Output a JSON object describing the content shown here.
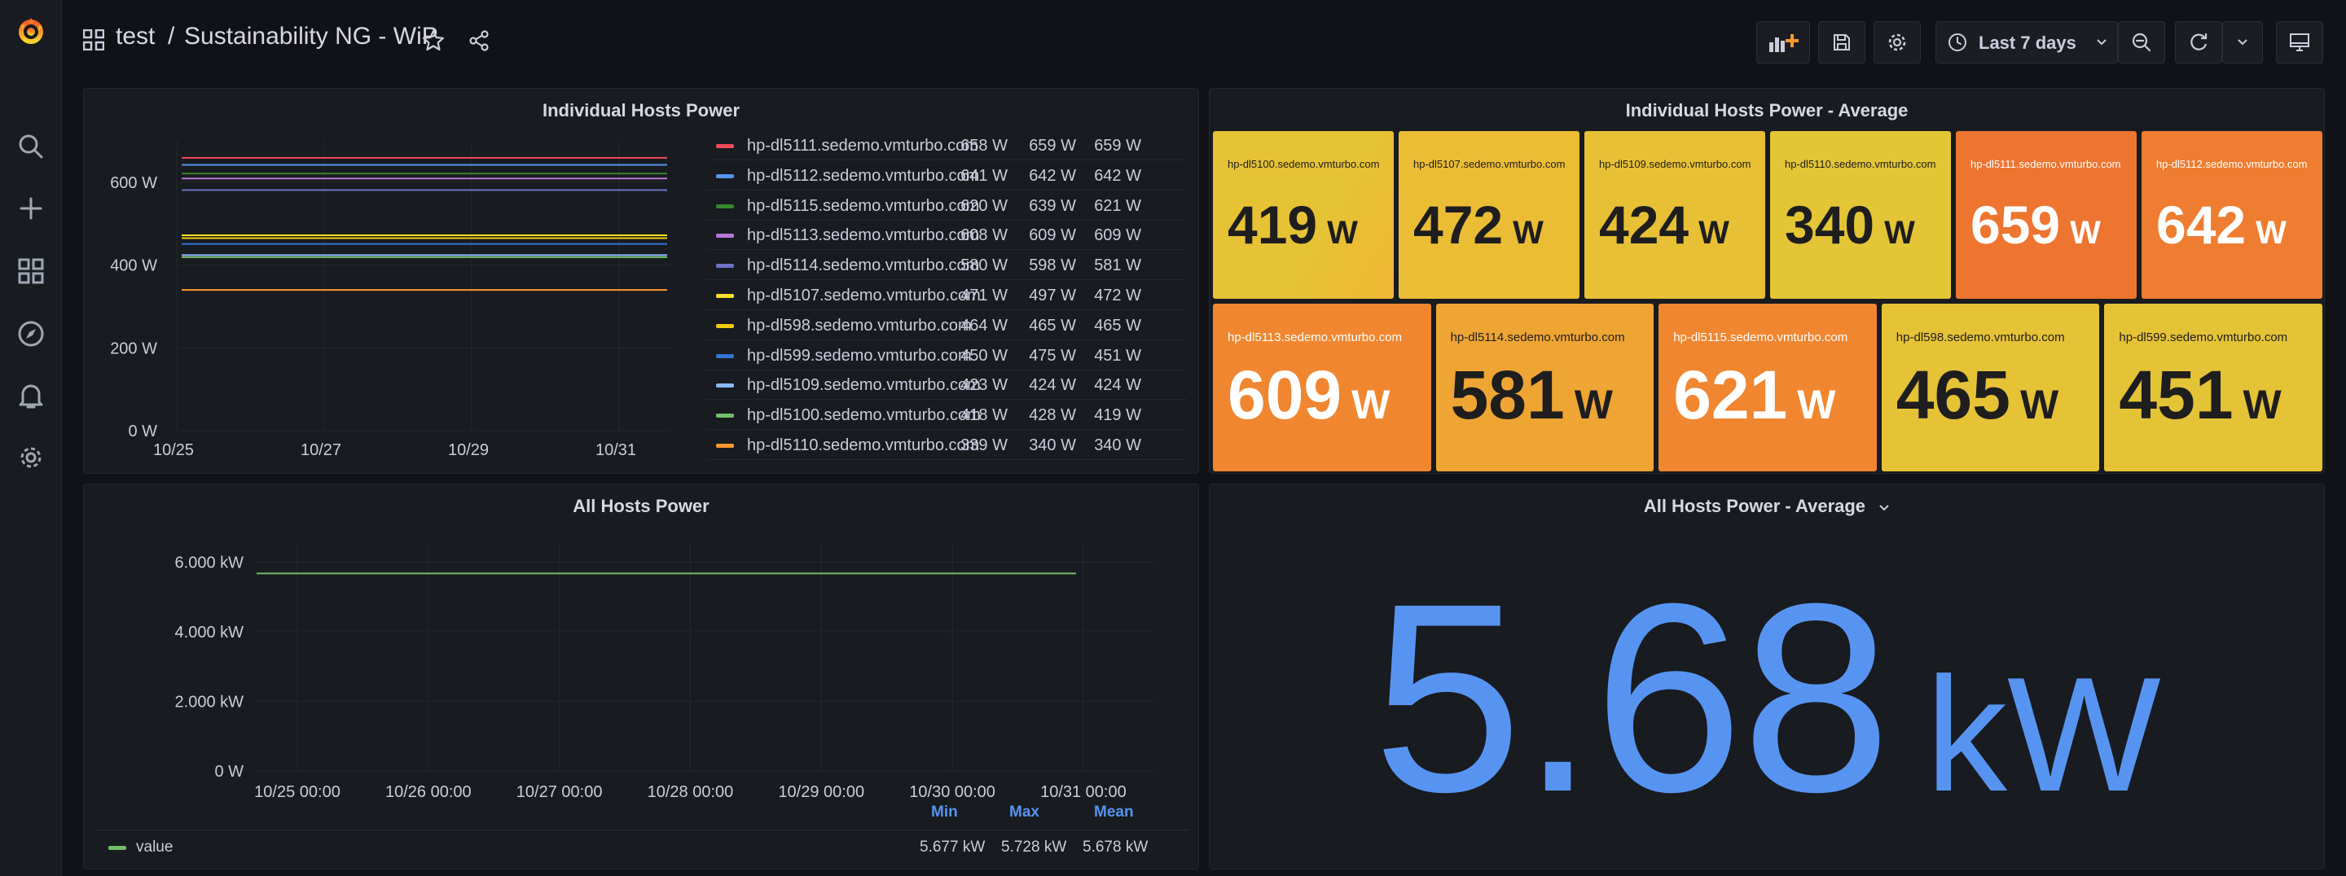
{
  "breadcrumb": {
    "folder": "test",
    "separator": "/",
    "dashboard": "Sustainability NG - WiP"
  },
  "toolbar": {
    "time_range": "Last 7 days"
  },
  "panels": {
    "individual_power": {
      "title": "Individual Hosts Power",
      "y_ticks": [
        "600 W",
        "400 W",
        "200 W",
        "0 W"
      ],
      "x_ticks": [
        "10/25",
        "10/27",
        "10/29",
        "10/31"
      ],
      "legend": [
        {
          "name": "hp-dl5111.sedemo.vmturbo.com",
          "color": "#f2495c",
          "min": "658 W",
          "max": "659 W",
          "last": "659 W",
          "level": 659
        },
        {
          "name": "hp-dl5112.sedemo.vmturbo.com",
          "color": "#5794f2",
          "min": "641 W",
          "max": "642 W",
          "last": "642 W",
          "level": 642
        },
        {
          "name": "hp-dl5115.sedemo.vmturbo.com",
          "color": "#37872d",
          "min": "620 W",
          "max": "639 W",
          "last": "621 W",
          "level": 621
        },
        {
          "name": "hp-dl5113.sedemo.vmturbo.com",
          "color": "#b877d9",
          "min": "608 W",
          "max": "609 W",
          "last": "609 W",
          "level": 609
        },
        {
          "name": "hp-dl5114.sedemo.vmturbo.com",
          "color": "#6e73c7",
          "min": "580 W",
          "max": "598 W",
          "last": "581 W",
          "level": 581
        },
        {
          "name": "hp-dl5107.sedemo.vmturbo.com",
          "color": "#fade2a",
          "min": "471 W",
          "max": "497 W",
          "last": "472 W",
          "level": 472
        },
        {
          "name": "hp-dl598.sedemo.vmturbo.com",
          "color": "#f2cc0c",
          "min": "464 W",
          "max": "465 W",
          "last": "465 W",
          "level": 465
        },
        {
          "name": "hp-dl599.sedemo.vmturbo.com",
          "color": "#3274d9",
          "min": "450 W",
          "max": "475 W",
          "last": "451 W",
          "level": 451
        },
        {
          "name": "hp-dl5109.sedemo.vmturbo.com",
          "color": "#8ab8ff",
          "min": "423 W",
          "max": "424 W",
          "last": "424 W",
          "level": 424
        },
        {
          "name": "hp-dl5100.sedemo.vmturbo.com",
          "color": "#73bf69",
          "min": "418 W",
          "max": "428 W",
          "last": "419 W",
          "level": 419
        },
        {
          "name": "hp-dl5110.sedemo.vmturbo.com",
          "color": "#ff9830",
          "min": "339 W",
          "max": "340 W",
          "last": "340 W",
          "level": 340
        }
      ]
    },
    "individual_avg": {
      "title": "Individual Hosts Power - Average",
      "tiles": [
        {
          "name": "hp-dl5100.sedemo.vmturbo.com",
          "value": "419",
          "unit": "W",
          "color": "#e6c235"
        },
        {
          "name": "hp-dl5107.sedemo.vmturbo.com",
          "value": "472",
          "unit": "W",
          "color": "#ebbd35"
        },
        {
          "name": "hp-dl5109.sedemo.vmturbo.com",
          "value": "424",
          "unit": "W",
          "color": "#e8c035"
        },
        {
          "name": "hp-dl5110.sedemo.vmturbo.com",
          "value": "340",
          "unit": "W",
          "color": "#e3c536"
        },
        {
          "name": "hp-dl5111.sedemo.vmturbo.com",
          "value": "659",
          "unit": "W",
          "color": "#ee7530"
        },
        {
          "name": "hp-dl5112.sedemo.vmturbo.com",
          "value": "642",
          "unit": "W",
          "color": "#ef7d31"
        },
        {
          "name": "hp-dl5113.sedemo.vmturbo.com",
          "value": "609",
          "unit": "W",
          "color": "#f0862f"
        },
        {
          "name": "hp-dl5114.sedemo.vmturbo.com",
          "value": "581",
          "unit": "W",
          "color": "#efa534"
        },
        {
          "name": "hp-dl5115.sedemo.vmturbo.com",
          "value": "621",
          "unit": "W",
          "color": "#f08630"
        },
        {
          "name": "hp-dl598.sedemo.vmturbo.com",
          "value": "465",
          "unit": "W",
          "color": "#e6c236"
        },
        {
          "name": "hp-dl599.sedemo.vmturbo.com",
          "value": "451",
          "unit": "W",
          "color": "#e5c336"
        }
      ]
    },
    "all_power": {
      "title": "All Hosts Power",
      "y_ticks": [
        "6.000 kW",
        "4.000 kW",
        "2.000 kW",
        "0 W"
      ],
      "x_ticks": [
        "10/25 00:00",
        "10/26 00:00",
        "10/27 00:00",
        "10/28 00:00",
        "10/29 00:00",
        "10/30 00:00",
        "10/31 00:00"
      ],
      "legend_headers": [
        "Min",
        "Max",
        "Mean"
      ],
      "legend": [
        {
          "name": "value",
          "color": "#73bf69",
          "min": "5.677 kW",
          "max": "5.728 kW",
          "mean": "5.678 kW"
        }
      ]
    },
    "all_avg": {
      "title": "All Hosts Power - Average",
      "value": "5.68",
      "unit": "kW",
      "color": "#5794f2"
    }
  },
  "chart_data": [
    {
      "type": "line",
      "title": "Individual Hosts Power",
      "x": [
        "10/25",
        "10/27",
        "10/29",
        "10/31"
      ],
      "ylim": [
        0,
        700
      ],
      "series": [
        {
          "name": "hp-dl5111.sedemo.vmturbo.com",
          "values": [
            659,
            659,
            659,
            659
          ]
        },
        {
          "name": "hp-dl5112.sedemo.vmturbo.com",
          "values": [
            642,
            642,
            642,
            642
          ]
        },
        {
          "name": "hp-dl5115.sedemo.vmturbo.com",
          "values": [
            621,
            621,
            621,
            621
          ]
        },
        {
          "name": "hp-dl5113.sedemo.vmturbo.com",
          "values": [
            609,
            609,
            609,
            609
          ]
        },
        {
          "name": "hp-dl5114.sedemo.vmturbo.com",
          "values": [
            581,
            581,
            581,
            581
          ]
        },
        {
          "name": "hp-dl5107.sedemo.vmturbo.com",
          "values": [
            472,
            472,
            472,
            472
          ]
        },
        {
          "name": "hp-dl598.sedemo.vmturbo.com",
          "values": [
            465,
            465,
            465,
            465
          ]
        },
        {
          "name": "hp-dl599.sedemo.vmturbo.com",
          "values": [
            451,
            451,
            451,
            451
          ]
        },
        {
          "name": "hp-dl5109.sedemo.vmturbo.com",
          "values": [
            424,
            424,
            424,
            424
          ]
        },
        {
          "name": "hp-dl5100.sedemo.vmturbo.com",
          "values": [
            419,
            419,
            419,
            419
          ]
        },
        {
          "name": "hp-dl5110.sedemo.vmturbo.com",
          "values": [
            340,
            340,
            340,
            340
          ]
        }
      ]
    },
    {
      "type": "line",
      "title": "All Hosts Power",
      "x": [
        "10/25 00:00",
        "10/26 00:00",
        "10/27 00:00",
        "10/28 00:00",
        "10/29 00:00",
        "10/30 00:00",
        "10/31 00:00"
      ],
      "ylim": [
        0,
        6600
      ],
      "series": [
        {
          "name": "value",
          "values": [
            5678,
            5678,
            5678,
            5678,
            5678,
            5678,
            5678
          ]
        }
      ]
    }
  ]
}
